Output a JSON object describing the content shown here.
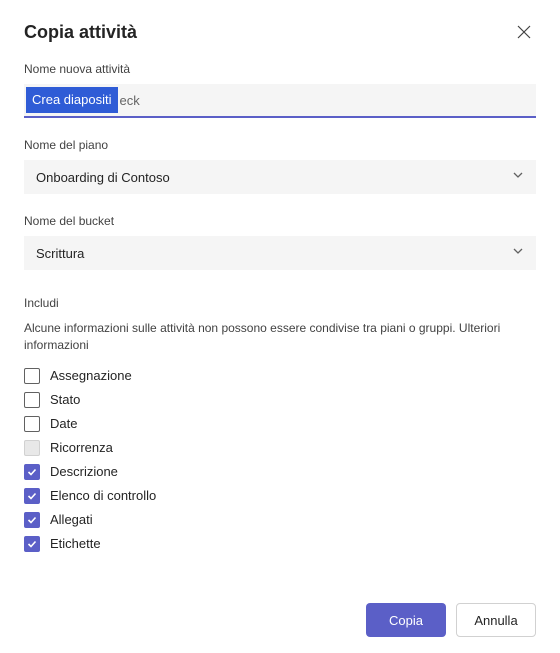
{
  "dialog": {
    "title": "Copia attività",
    "close_icon": "close"
  },
  "fields": {
    "task_name": {
      "label": "Nome nuova attività",
      "value_selected": "Crea diapositi",
      "value_suffix": "eck"
    },
    "plan_name": {
      "label": "Nome del piano",
      "value": "Onboarding di Contoso"
    },
    "bucket_name": {
      "label": "Nome del bucket",
      "value": "Scrittura"
    }
  },
  "include": {
    "heading": "Includi",
    "note_text": "Alcune informazioni sulle attività non possono essere condivise tra piani o gruppi. ",
    "note_link": "Ulteriori informazioni",
    "options": [
      {
        "label": "Assegnazione",
        "checked": false,
        "disabled": false
      },
      {
        "label": "Stato",
        "checked": false,
        "disabled": false
      },
      {
        "label": "Date",
        "checked": false,
        "disabled": false
      },
      {
        "label": "Ricorrenza",
        "checked": false,
        "disabled": true
      },
      {
        "label": "Descrizione",
        "checked": true,
        "disabled": false
      },
      {
        "label": "Elenco di controllo",
        "checked": true,
        "disabled": false
      },
      {
        "label": "Allegati",
        "checked": true,
        "disabled": false
      },
      {
        "label": "Etichette",
        "checked": true,
        "disabled": false
      }
    ]
  },
  "footer": {
    "primary": "Copia",
    "secondary": "Annulla"
  }
}
